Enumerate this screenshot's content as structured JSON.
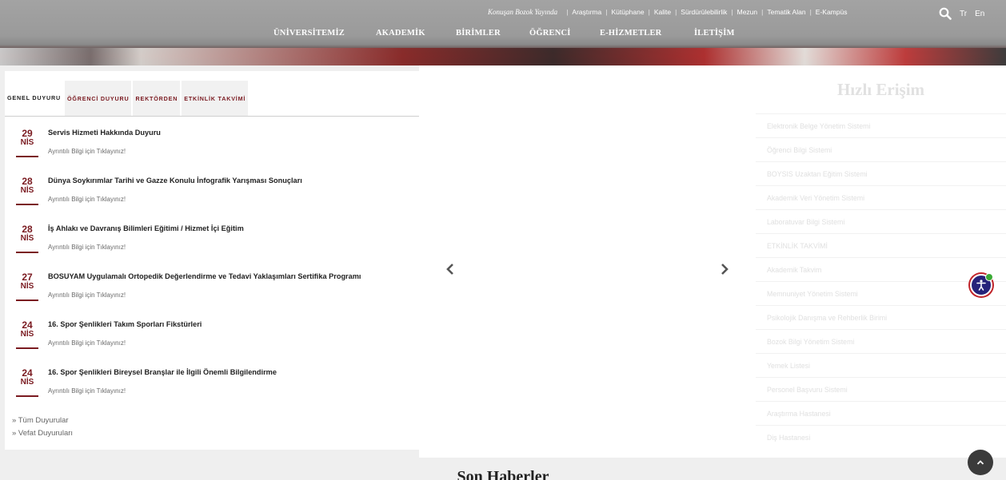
{
  "header": {
    "tagline": "Konuşan Bozok Yayında",
    "top_links": [
      "Araştırma",
      "Kütüphane",
      "Kalite",
      "Sürdürülebilirlik",
      "Mezun",
      "Tematik Alan",
      "E-Kampüs"
    ],
    "nav": [
      "ÜNİVERSİTEMİZ",
      "AKADEMİK",
      "BİRİMLER",
      "ÖĞRENCİ",
      "E-HİZMETLER",
      "İLETİŞİM"
    ],
    "lang_tr": "Tr",
    "lang_en": "En",
    "search_icon": "search-icon"
  },
  "announcements": {
    "tabs": [
      "GENEL DUYURU",
      "ÖĞRENCİ DUYURU",
      "REKTÖRDEN",
      "ETKİNLİK TAKVİMİ"
    ],
    "active_tab": "GENEL DUYURU",
    "items": [
      {
        "day": "29",
        "month": "NİS",
        "title": "Servis Hizmeti Hakkında Duyuru",
        "more": "Ayrıntılı Bilgi için Tıklayınız!"
      },
      {
        "day": "28",
        "month": "NİS",
        "title": "Dünya Soykırımlar Tarihi ve Gazze Konulu İnfografik Yarışması Sonuçları",
        "more": "Ayrıntılı Bilgi için Tıklayınız!"
      },
      {
        "day": "28",
        "month": "NİS",
        "title": "İş Ahlakı ve Davranış Bilimleri Eğitimi / Hizmet İçi Eğitim",
        "more": "Ayrıntılı Bilgi için Tıklayınız!"
      },
      {
        "day": "27",
        "month": "NİS",
        "title": "BOSUYAM Uygulamalı Ortopedik Değerlendirme ve Tedavi Yaklaşımları Sertifika Programı",
        "more": "Ayrıntılı Bilgi için Tıklayınız!"
      },
      {
        "day": "24",
        "month": "NİS",
        "title": "16. Spor Şenlikleri Takım Sporları Fikstürleri",
        "more": "Ayrıntılı Bilgi için Tıklayınız!"
      },
      {
        "day": "24",
        "month": "NİS",
        "title": "16. Spor Şenlikleri Bireysel Branşlar ile İlgili Önemli Bilgilendirme",
        "more": "Ayrıntılı Bilgi için Tıklayınız!"
      }
    ],
    "all_link": "» Tüm Duyurular",
    "obituary_link": "» Vefat Duyuruları"
  },
  "slider": {
    "prev_icon": "chevron-left-icon",
    "next_icon": "chevron-right-icon"
  },
  "quick_access": {
    "title": "Hızlı Erişim",
    "items": [
      "Elektronik Belge Yönetim Sistemi",
      "Öğrenci Bilgi Sistemi",
      "BOYSIS Uzaktan Eğitim Sistemi",
      "Akademik Veri Yönetim Sistemi",
      "Laboratuvar Bilgi Sistemi",
      "ETKİNLİK TAKVİMİ",
      "Akademik Takvim",
      "Memnuniyet Yönetim Sistemi",
      "Psikolojik Danışma ve Rehberlik Birimi",
      "Bozok Bilgi Yönetim Sistemi",
      "Yemek Listesi",
      "Personel Başvuru Sistemi",
      "Araştırma Hastanesi",
      "Diş Hastanesi"
    ]
  },
  "news": {
    "title": "Son Haberler"
  },
  "colors": {
    "accent": "#7a1a20",
    "accessibility": "#26237a"
  }
}
